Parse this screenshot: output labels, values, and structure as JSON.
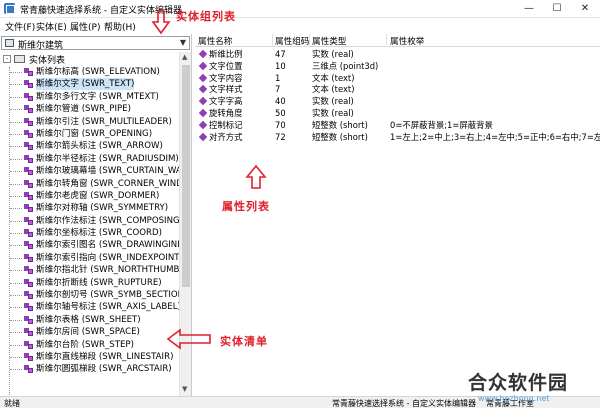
{
  "window": {
    "title": "常青藤快速选择系统 - 自定义实体编辑器",
    "minimize_glyph": "—",
    "maximize_glyph": "☐",
    "close_glyph": "✕"
  },
  "menu": [
    "文件(F)",
    "实体(E)",
    "属性(P)",
    "帮助(H)"
  ],
  "annotations": {
    "entity_group_list": "实体组列表",
    "property_list": "属性列表",
    "entity_list": "实体清单"
  },
  "left_panel": {
    "group_combo": "斯维尔建筑",
    "combo_arrow": "▼",
    "tree_root_toggle": "-",
    "tree_root": "实体列表",
    "items": [
      "斯维尔标高 (SWR_ELEVATION)",
      "斯维尔文字 (SWR_TEXT)",
      "斯维尔多行文字 (SWR_MTEXT)",
      "斯维尔管道 (SWR_PIPE)",
      "斯维尔引注 (SWR_MULTILEADER)",
      "斯维尔门窗 (SWR_OPENING)",
      "斯维尔箭头标注 (SWR_ARROW)",
      "斯维尔半径标注 (SWR_RADIUSDIM)",
      "斯维尔玻璃幕墙 (SWR_CURTAIN_WALL",
      "斯维尔转角窗 (SWR_CORNER_WINDO",
      "斯维尔老虎窗 (SWR_DORMER)",
      "斯维尔对称轴 (SWR_SYMMETRY)",
      "斯维尔作法标注 (SWR_COMPOSING)",
      "斯维尔坐标标注 (SWR_COORD)",
      "斯维尔索引图名 (SWR_DRAWINGINDE",
      "斯维尔索引指向 (SWR_INDEXPOINTER",
      "斯维尔指北针 (SWR_NORTHTHUMB)",
      "斯维尔折断线 (SWR_RUPTURE)",
      "斯维尔剖切号 (SWR_SYMB_SECTION)",
      "斯维尔轴号标注 (SWR_AXIS_LABEL)",
      "斯维尔表格 (SWR_SHEET)",
      "斯维尔房间 (SWR_SPACE)",
      "斯维尔台阶 (SWR_STEP)",
      "斯维尔直线梯段 (SWR_LINESTAIR)",
      "斯维尔圆弧梯段 (SWR_ARCSTAIR)"
    ],
    "scroll_up": "▲",
    "scroll_down": "▼"
  },
  "property_grid": {
    "columns": [
      "属性名称",
      "属性组码",
      "属性类型",
      "属性枚举"
    ],
    "rows": [
      {
        "name": "斯维比例",
        "code": "47",
        "type": "实数 (real)",
        "enum": ""
      },
      {
        "name": "文字位置",
        "code": "10",
        "type": "三维点 (point3d)",
        "enum": ""
      },
      {
        "name": "文字内容",
        "code": "1",
        "type": "文本 (text)",
        "enum": ""
      },
      {
        "name": "文字样式",
        "code": "7",
        "type": "文本 (text)",
        "enum": ""
      },
      {
        "name": "文字字高",
        "code": "40",
        "type": "实数 (real)",
        "enum": ""
      },
      {
        "name": "旋转角度",
        "code": "50",
        "type": "实数 (real)",
        "enum": ""
      },
      {
        "name": "控制标记",
        "code": "70",
        "type": "短整数 (short)",
        "enum": "0=不屏蔽背景;1=屏蔽背景"
      },
      {
        "name": "对齐方式",
        "code": "72",
        "type": "短整数 (short)",
        "enum": "1=左上;2=中上;3=右上;4=左中;5=正中;6=右中;7=左下;8=中"
      }
    ]
  },
  "statusbar": {
    "left": "就绪",
    "middle": "常青藤快速选择系统 - 自定义实体编辑器",
    "right": "常青藤工作室"
  },
  "watermark": {
    "logo": "合众软件园",
    "url": "www.hezhong.net"
  }
}
